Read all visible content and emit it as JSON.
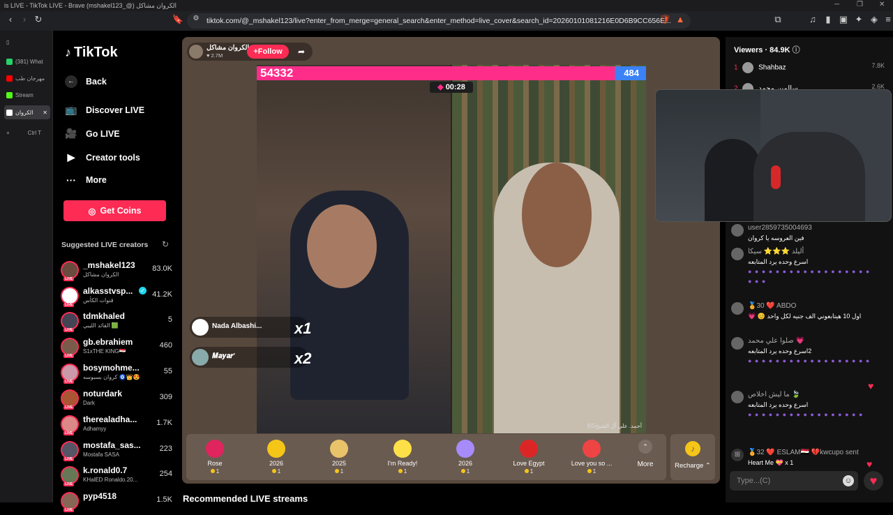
{
  "browser": {
    "title": "is LIVE - TikTok LIVE - Brave (mshakel123_@) الكروان مشاكل",
    "url": "tiktok.com/@_mshakel123/live?enter_from_merge=general_search&enter_method=live_cover&search_id=20260101081216E0D6B9CC656E...",
    "tabs": [
      {
        "label": "(381) What",
        "color": "#25d366"
      },
      {
        "label": "مهرجان طب",
        "color": "#ff0000"
      },
      {
        "label": "Stream",
        "color": "#53fc18"
      },
      {
        "label": "الكروان",
        "color": "#ffffff"
      }
    ],
    "new_tab": "+",
    "shortcut": "Ctrl  T"
  },
  "sidebar": {
    "logo": "TikTok",
    "nav": [
      {
        "label": "Back",
        "icon": "arrow-left-icon"
      },
      {
        "label": "Discover LIVE",
        "icon": "tv-icon"
      },
      {
        "label": "Go LIVE",
        "icon": "camera-icon"
      },
      {
        "label": "Creator tools",
        "icon": "play-icon"
      },
      {
        "label": "More",
        "icon": "dots-icon"
      }
    ],
    "get_coins": "Get Coins",
    "suggested_title": "Suggested LIVE creators",
    "live_badge": "LIVE",
    "creators": [
      {
        "name": "_mshakel123",
        "sub": "الكروان مشاكل",
        "count": "83.0K"
      },
      {
        "name": "alkasstvsp...",
        "sub": "قنوات الكأس",
        "count": "41.2K"
      },
      {
        "name": "tdmkhaled",
        "sub": "القائد الليبي 🟩",
        "count": "5"
      },
      {
        "name": "gb.ebrahiem",
        "sub": "S1xTHE KING🇪🇬",
        "count": "460"
      },
      {
        "name": "bosymohme...",
        "sub": "كروان بسبوسه 🧿👑😍",
        "count": "55"
      },
      {
        "name": "noturdark",
        "sub": "Dark",
        "count": "309"
      },
      {
        "name": "therealadha...",
        "sub": "Adhamyy",
        "count": "1.7K"
      },
      {
        "name": "mostafa_sas...",
        "sub": "Mostafa SASA",
        "count": "223"
      },
      {
        "name": "k.ronald0.7",
        "sub": "KHalED Ronaldo.20...",
        "count": "254"
      },
      {
        "name": "pyp4518",
        "sub": "",
        "count": "1.5K"
      }
    ]
  },
  "live": {
    "host_name": "الكروان مشاكل",
    "host_likes": "♥ 2.7M",
    "follow": "+Follow",
    "score_left": "54332",
    "score_right": "484",
    "timer": "00:28",
    "watermark": "EGأحمد. علي أل الشيخ",
    "gift_notifications": [
      {
        "user": "Nada Albashi...",
        "count": "x1"
      },
      {
        "user": "𝑴𝒂𝒚𝒂𝒓'",
        "count": "x2"
      }
    ],
    "gifts": [
      {
        "name": "Rose",
        "price": "1",
        "color": "#e0245e"
      },
      {
        "name": "2026",
        "price": "1",
        "color": "#f5c518"
      },
      {
        "name": "2025",
        "price": "1",
        "color": "#e8c36a"
      },
      {
        "name": "I'm Ready!",
        "price": "1",
        "color": "#fde047"
      },
      {
        "name": "2026",
        "price": "1",
        "color": "#a78bfa"
      },
      {
        "name": "Love Egypt",
        "price": "1",
        "color": "#dc2626"
      },
      {
        "name": "Love you so ...",
        "price": "1",
        "color": "#ef4444"
      }
    ],
    "more": "More",
    "recharge": "Recharge",
    "recommended": "Recommended LIVE streams"
  },
  "chat": {
    "viewers_label": "Viewers",
    "viewers_count": "84.9K",
    "top_viewers": [
      {
        "rank": "1",
        "name": "Shahbaz",
        "score": "7.8K"
      },
      {
        "rank": "2",
        "name": "سالمين محمد",
        "score": "2.6K"
      }
    ],
    "messages": [
      {
        "user": "user2859735004693",
        "text": "فين العروسه يا كروان"
      },
      {
        "user": "أليلد ⭐⭐⭐ سيكا",
        "text": "اسرع وحده يرد المتابعه"
      },
      {
        "user": "🏅30 ❤️ ABDO",
        "text": "اول 10 هيتابعوني الف جنيه لكل واحد 😊 💗"
      },
      {
        "user": "صلوا علي محمد 💗",
        "text": "2اسرع وحده يرد المتابعه"
      },
      {
        "user": "ما ليش اخلاص 🍃",
        "text": "اسرع وحده يرد المتابعه"
      },
      {
        "user": "🏅32 ❤️ ESLAM🇪🇬 💔kwcupo sent",
        "text": "Heart Me 💝 x 1"
      }
    ],
    "input_placeholder": "Type...(C)"
  }
}
